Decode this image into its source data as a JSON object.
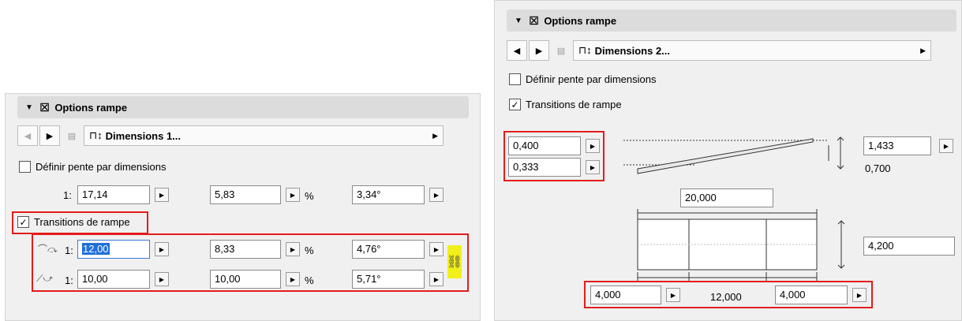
{
  "left": {
    "header_title": "Options rampe",
    "nav_dropdown": "Dimensions 1...",
    "define_slope_label": "Définir pente par dimensions",
    "define_slope_checked": false,
    "row1": {
      "prefix": "1:",
      "ratio": "17,14",
      "percent": "5,83",
      "percent_unit": "%",
      "angle": "3,34°"
    },
    "transitions_label": "Transitions de rampe",
    "transitions_checked": true,
    "trans1": {
      "prefix": "1:",
      "ratio": "12,00",
      "percent": "8,33",
      "percent_unit": "%",
      "angle": "4,76°"
    },
    "trans2": {
      "prefix": "1:",
      "ratio": "10,00",
      "percent": "10,00",
      "percent_unit": "%",
      "angle": "5,71°"
    }
  },
  "right": {
    "header_title": "Options rampe",
    "nav_dropdown": "Dimensions 2...",
    "define_slope_label": "Définir pente par dimensions",
    "define_slope_checked": false,
    "transitions_label": "Transitions de rampe",
    "transitions_checked": true,
    "trans_top": "0,400",
    "trans_bottom": "0,333",
    "height_total": "1,433",
    "height_static": "0,700",
    "plan_width": "20,000",
    "plan_depth": "4,200",
    "seg_left": "4,000",
    "seg_middle": "12,000",
    "seg_right": "4,000"
  },
  "icons": {
    "check": "✓",
    "collapse": "▼",
    "prev": "◀",
    "next": "▶",
    "link": "⛓"
  },
  "colors": {
    "highlight_red": "#e31c1c",
    "link_yellow": "#f2f01a",
    "selection_blue": "#1e6fd9"
  }
}
